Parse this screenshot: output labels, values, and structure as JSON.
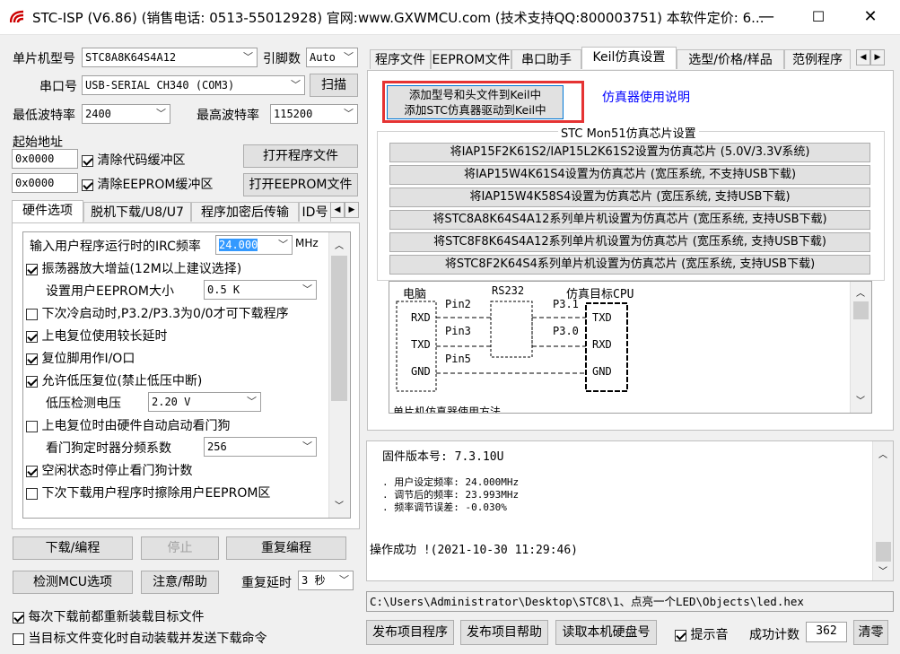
{
  "titlebar": {
    "title": "STC-ISP (V6.86) (销售电话: 0513-55012928) 官网:www.GXWMCU.com (技术支持QQ:800003751) 本软件定价: 6...",
    "minimize": "—",
    "maximize": "☐",
    "close": "✕"
  },
  "mcu": {
    "label": "单片机型号",
    "value": "STC8A8K64S4A12",
    "pins_label": "引脚数",
    "pins_value": "Auto"
  },
  "port": {
    "label": "串口号",
    "value": "USB-SERIAL CH340 (COM3)",
    "scan": "扫描"
  },
  "baud": {
    "min_label": "最低波特率",
    "min_value": "2400",
    "max_label": "最高波特率",
    "max_value": "115200"
  },
  "start": {
    "label": "起始地址",
    "addr1": "0x0000",
    "clear_code": "清除代码缓冲区",
    "open_prog": "打开程序文件",
    "addr2": "0x0000",
    "clear_eeprom": "清除EEPROM缓冲区",
    "open_eeprom": "打开EEPROM文件"
  },
  "left_tabs": [
    "硬件选项",
    "脱机下载/U8/U7",
    "程序加密后传输",
    "ID号"
  ],
  "hw": {
    "irc_label": "输入用户程序运行时的IRC频率",
    "irc_value": "24.000",
    "irc_unit": "MHz",
    "osc_gain": "振荡器放大增益(12M以上建议选择)",
    "eeprom_label": "设置用户EEPROM大小",
    "eeprom_value": "0.5 K",
    "cold_start": "下次冷启动时,P3.2/P3.3为0/0才可下载程序",
    "long_delay": "上电复位使用较长延时",
    "reset_io": "复位脚用作I/O口",
    "low_volt_reset": "允许低压复位(禁止低压中断)",
    "low_volt_label": "低压检测电压",
    "low_volt_value": "2.20 V",
    "wdt_auto": "上电复位时由硬件自动启动看门狗",
    "wdt_div_label": "看门狗定时器分频系数",
    "wdt_div_value": "256",
    "wdt_idle": "空闲状态时停止看门狗计数",
    "erase_eeprom": "下次下载用户程序时擦除用户EEPROM区"
  },
  "actions": {
    "download": "下载/编程",
    "stop": "停止",
    "redo": "重复编程",
    "check_mcu": "检测MCU选项",
    "help": "注意/帮助",
    "delay_label": "重复延时",
    "delay_value": "3 秒",
    "reload": "每次下载前都重新装载目标文件",
    "auto_send": "当目标文件变化时自动装载并发送下载命令"
  },
  "right_tabs": [
    "程序文件",
    "EEPROM文件",
    "串口助手",
    "Keil仿真设置",
    "选型/价格/样品",
    "范例程序"
  ],
  "keil": {
    "add_btn_line1": "添加型号和头文件到Keil中",
    "add_btn_line2": "添加STC仿真器驱动到Keil中",
    "manual_link": "仿真器使用说明",
    "group_label": "STC Mon51仿真芯片设置",
    "sim_buttons": [
      "将IAP15F2K61S2/IAP15L2K61S2设置为仿真芯片 (5.0V/3.3V系统)",
      "将IAP15W4K61S4设置为仿真芯片 (宽压系统, 不支持USB下载)",
      "将IAP15W4K58S4设置为仿真芯片 (宽压系统, 支持USB下载)",
      "将STC8A8K64S4A12系列单片机设置为仿真芯片 (宽压系统, 支持USB下载)",
      "将STC8F8K64S4A12系列单片机设置为仿真芯片 (宽压系统, 支持USB下载)",
      "将STC8F2K64S4系列单片机设置为仿真芯片 (宽压系统, 支持USB下载)"
    ],
    "diagram": {
      "pc": "电脑",
      "rs232": "RS232",
      "target": "仿真目标CPU",
      "rxd": "RXD",
      "txd": "TXD",
      "gnd": "GND",
      "pin2": "Pin2",
      "pin3": "Pin3",
      "pin5": "Pin5",
      "p31": "P3.1",
      "p30": "P3.0",
      "footer": "单片机仿真器使用方法"
    }
  },
  "log": {
    "firmware": "固件版本号: 7.3.10U",
    "line1": ". 用户设定频率: 24.000MHz",
    "line2": ". 调节后的频率: 23.993MHz",
    "line3": ". 频率调节误差: -0.030%",
    "result": "操作成功 !(2021-10-30 11:29:46)"
  },
  "filepath": "C:\\Users\\Administrator\\Desktop\\STC8\\1、点亮一个LED\\Objects\\led.hex",
  "bottom": {
    "publish": "发布项目程序",
    "publish_help": "发布项目帮助",
    "read_disk": "读取本机硬盘号",
    "sound": "提示音",
    "count_label": "成功计数",
    "count_value": "362",
    "clear": "清零"
  },
  "colors": {
    "highlight": "#e53333",
    "link": "#0000ff",
    "selection": "#3399ff"
  }
}
